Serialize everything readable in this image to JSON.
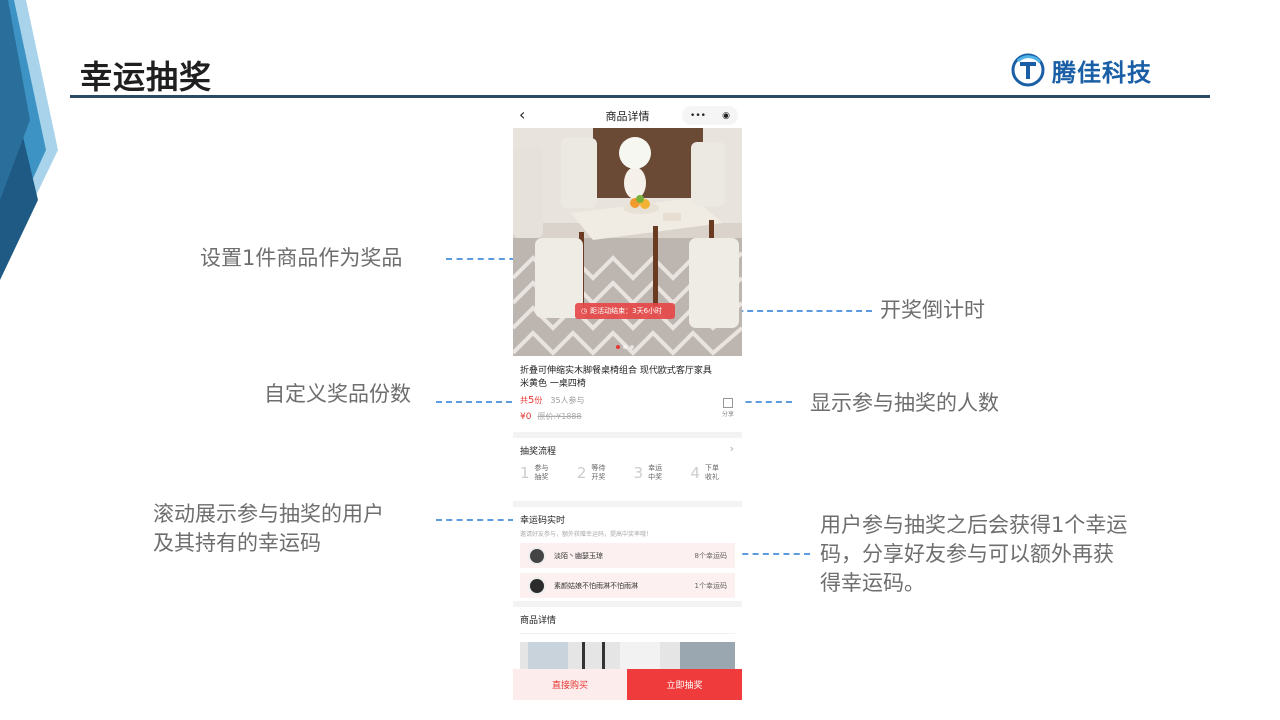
{
  "slide": {
    "title": "幸运抽奖",
    "logo_text": "腾佳科技"
  },
  "annotations": {
    "prize": "设置1件商品作为奖品",
    "countdown": "开奖倒计时",
    "quantity": "自定义奖品份数",
    "participants": "显示参与抽奖的人数",
    "scroll_line1": "滚动展示参与抽奖的用户",
    "scroll_line2": "及其持有的幸运码",
    "code_line1": "用户参与抽奖之后会获得1个幸运",
    "code_line2": "码，分享好友参与可以额外再获",
    "code_line3": "得幸运码。"
  },
  "phone": {
    "nav": {
      "back": "‹",
      "title": "商品详情",
      "more": "•••",
      "target": "◉"
    },
    "hero": {
      "countdown_label": "距活动结束：3天6小时"
    },
    "product": {
      "name_line1": "折叠可伸缩实木脚餐桌椅组合 现代欧式客厅家具",
      "name_line2": "米黄色 一桌四椅",
      "qty_prefix": "共",
      "qty_value": "5",
      "qty_suffix": "份",
      "participants": "35人参与",
      "price": "¥0",
      "orig_price": "原价:¥1888",
      "share": "分享"
    },
    "flow": {
      "title": "抽奖流程",
      "steps": [
        {
          "num": "1",
          "line1": "参与",
          "line2": "抽奖"
        },
        {
          "num": "2",
          "line1": "等待",
          "line2": "开奖"
        },
        {
          "num": "3",
          "line1": "幸运",
          "line2": "中奖"
        },
        {
          "num": "4",
          "line1": "下单",
          "line2": "收礼"
        }
      ]
    },
    "codes": {
      "title": "幸运码实时",
      "subtitle": "邀请好友参与，额外获赠幸运码，提高中奖率哦！",
      "rows": [
        {
          "user": "淡陌丶幽瑟玉琼",
          "count": "8个幸运码"
        },
        {
          "user": "素颜姑娘不怕雨淋不怕雨淋",
          "count": "1个幸运码"
        }
      ]
    },
    "detail": {
      "title": "商品详情"
    },
    "buttons": {
      "buy": "直接购买",
      "draw": "立即抽奖"
    }
  },
  "colors": {
    "accent": "#ef3b3b",
    "annotation_line": "#5c9be0",
    "brand": "#1a5fa6",
    "rule": "#2b4b63"
  }
}
